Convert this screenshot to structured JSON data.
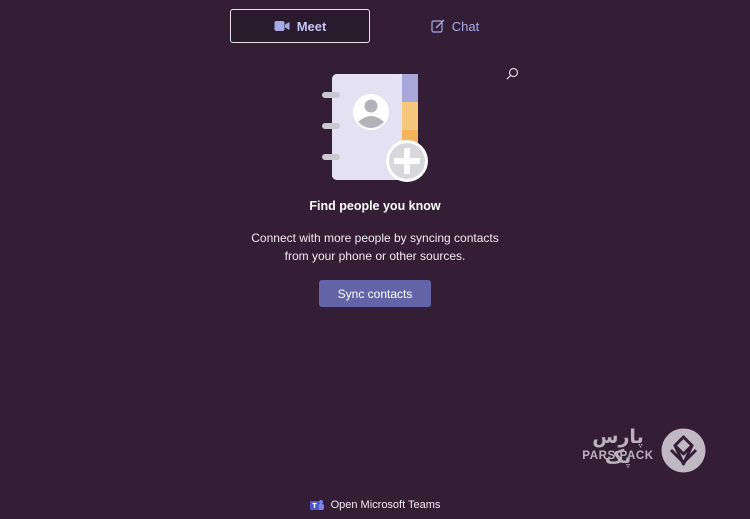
{
  "tabs": {
    "meet_label": "Meet",
    "chat_label": "Chat"
  },
  "empty_state": {
    "heading": "Find people you know",
    "description_line1": "Connect with more people by syncing contacts",
    "description_line2": "from your phone or other sources.",
    "sync_button_label": "Sync contacts"
  },
  "footer": {
    "open_teams_label": "Open Microsoft Teams"
  },
  "watermark": {
    "name_fa": "پارس پک",
    "name_en": "PARS PACK"
  },
  "icons": {
    "meet": "video-camera-icon",
    "chat": "compose-icon",
    "search": "search-icon",
    "illustration": "contacts-book-icon",
    "footer": "teams-logo-icon"
  },
  "colors": {
    "background": "#331e35",
    "accent": "#6264a7",
    "tab_text": "#c3c7f5"
  }
}
